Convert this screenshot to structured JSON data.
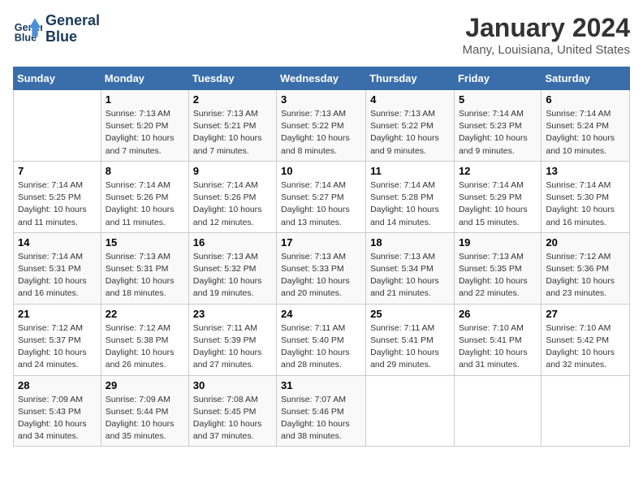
{
  "header": {
    "logo_line1": "General",
    "logo_line2": "Blue",
    "month": "January 2024",
    "location": "Many, Louisiana, United States"
  },
  "columns": [
    "Sunday",
    "Monday",
    "Tuesday",
    "Wednesday",
    "Thursday",
    "Friday",
    "Saturday"
  ],
  "weeks": [
    [
      {
        "day": "",
        "info": ""
      },
      {
        "day": "1",
        "info": "Sunrise: 7:13 AM\nSunset: 5:20 PM\nDaylight: 10 hours\nand 7 minutes."
      },
      {
        "day": "2",
        "info": "Sunrise: 7:13 AM\nSunset: 5:21 PM\nDaylight: 10 hours\nand 7 minutes."
      },
      {
        "day": "3",
        "info": "Sunrise: 7:13 AM\nSunset: 5:22 PM\nDaylight: 10 hours\nand 8 minutes."
      },
      {
        "day": "4",
        "info": "Sunrise: 7:13 AM\nSunset: 5:22 PM\nDaylight: 10 hours\nand 9 minutes."
      },
      {
        "day": "5",
        "info": "Sunrise: 7:14 AM\nSunset: 5:23 PM\nDaylight: 10 hours\nand 9 minutes."
      },
      {
        "day": "6",
        "info": "Sunrise: 7:14 AM\nSunset: 5:24 PM\nDaylight: 10 hours\nand 10 minutes."
      }
    ],
    [
      {
        "day": "7",
        "info": "Sunrise: 7:14 AM\nSunset: 5:25 PM\nDaylight: 10 hours\nand 11 minutes."
      },
      {
        "day": "8",
        "info": "Sunrise: 7:14 AM\nSunset: 5:26 PM\nDaylight: 10 hours\nand 11 minutes."
      },
      {
        "day": "9",
        "info": "Sunrise: 7:14 AM\nSunset: 5:26 PM\nDaylight: 10 hours\nand 12 minutes."
      },
      {
        "day": "10",
        "info": "Sunrise: 7:14 AM\nSunset: 5:27 PM\nDaylight: 10 hours\nand 13 minutes."
      },
      {
        "day": "11",
        "info": "Sunrise: 7:14 AM\nSunset: 5:28 PM\nDaylight: 10 hours\nand 14 minutes."
      },
      {
        "day": "12",
        "info": "Sunrise: 7:14 AM\nSunset: 5:29 PM\nDaylight: 10 hours\nand 15 minutes."
      },
      {
        "day": "13",
        "info": "Sunrise: 7:14 AM\nSunset: 5:30 PM\nDaylight: 10 hours\nand 16 minutes."
      }
    ],
    [
      {
        "day": "14",
        "info": "Sunrise: 7:14 AM\nSunset: 5:31 PM\nDaylight: 10 hours\nand 16 minutes."
      },
      {
        "day": "15",
        "info": "Sunrise: 7:13 AM\nSunset: 5:31 PM\nDaylight: 10 hours\nand 18 minutes."
      },
      {
        "day": "16",
        "info": "Sunrise: 7:13 AM\nSunset: 5:32 PM\nDaylight: 10 hours\nand 19 minutes."
      },
      {
        "day": "17",
        "info": "Sunrise: 7:13 AM\nSunset: 5:33 PM\nDaylight: 10 hours\nand 20 minutes."
      },
      {
        "day": "18",
        "info": "Sunrise: 7:13 AM\nSunset: 5:34 PM\nDaylight: 10 hours\nand 21 minutes."
      },
      {
        "day": "19",
        "info": "Sunrise: 7:13 AM\nSunset: 5:35 PM\nDaylight: 10 hours\nand 22 minutes."
      },
      {
        "day": "20",
        "info": "Sunrise: 7:12 AM\nSunset: 5:36 PM\nDaylight: 10 hours\nand 23 minutes."
      }
    ],
    [
      {
        "day": "21",
        "info": "Sunrise: 7:12 AM\nSunset: 5:37 PM\nDaylight: 10 hours\nand 24 minutes."
      },
      {
        "day": "22",
        "info": "Sunrise: 7:12 AM\nSunset: 5:38 PM\nDaylight: 10 hours\nand 26 minutes."
      },
      {
        "day": "23",
        "info": "Sunrise: 7:11 AM\nSunset: 5:39 PM\nDaylight: 10 hours\nand 27 minutes."
      },
      {
        "day": "24",
        "info": "Sunrise: 7:11 AM\nSunset: 5:40 PM\nDaylight: 10 hours\nand 28 minutes."
      },
      {
        "day": "25",
        "info": "Sunrise: 7:11 AM\nSunset: 5:41 PM\nDaylight: 10 hours\nand 29 minutes."
      },
      {
        "day": "26",
        "info": "Sunrise: 7:10 AM\nSunset: 5:41 PM\nDaylight: 10 hours\nand 31 minutes."
      },
      {
        "day": "27",
        "info": "Sunrise: 7:10 AM\nSunset: 5:42 PM\nDaylight: 10 hours\nand 32 minutes."
      }
    ],
    [
      {
        "day": "28",
        "info": "Sunrise: 7:09 AM\nSunset: 5:43 PM\nDaylight: 10 hours\nand 34 minutes."
      },
      {
        "day": "29",
        "info": "Sunrise: 7:09 AM\nSunset: 5:44 PM\nDaylight: 10 hours\nand 35 minutes."
      },
      {
        "day": "30",
        "info": "Sunrise: 7:08 AM\nSunset: 5:45 PM\nDaylight: 10 hours\nand 37 minutes."
      },
      {
        "day": "31",
        "info": "Sunrise: 7:07 AM\nSunset: 5:46 PM\nDaylight: 10 hours\nand 38 minutes."
      },
      {
        "day": "",
        "info": ""
      },
      {
        "day": "",
        "info": ""
      },
      {
        "day": "",
        "info": ""
      }
    ]
  ]
}
